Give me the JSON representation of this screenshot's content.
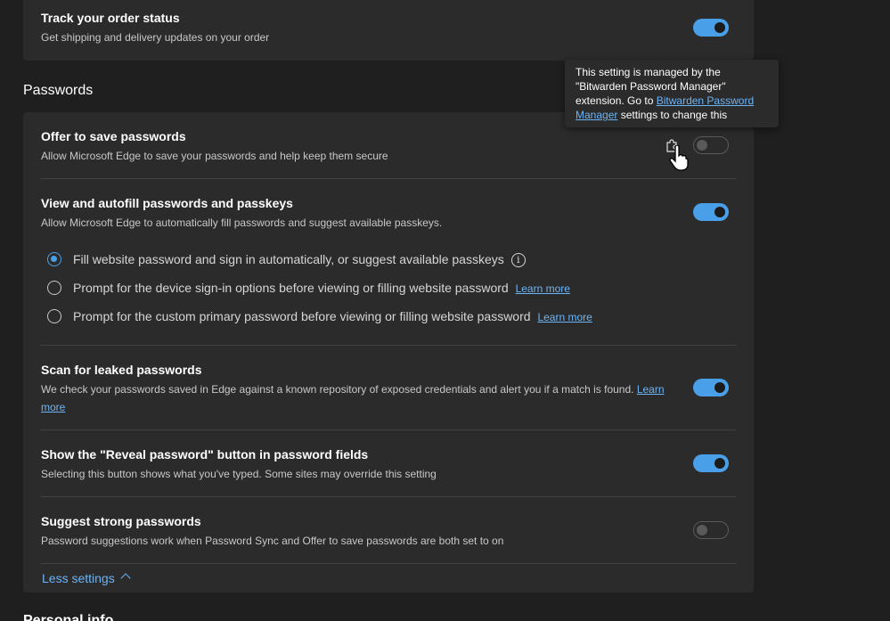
{
  "top_card": {
    "title": "Track your order status",
    "desc": "Get shipping and delivery updates on your order"
  },
  "passwords_section": {
    "heading": "Passwords",
    "offer_save": {
      "title": "Offer to save passwords",
      "desc": "Allow Microsoft Edge to save your passwords and help keep them secure"
    },
    "autofill": {
      "title": "View and autofill passwords and passkeys",
      "desc": "Allow Microsoft Edge to automatically fill passwords and suggest available passkeys.",
      "options": [
        {
          "label": "Fill website password and sign in automatically, or suggest available passkeys"
        },
        {
          "label": "Prompt for the device sign-in options before viewing or filling website password",
          "link": "Learn more"
        },
        {
          "label": "Prompt for the custom primary password before viewing or filling website password",
          "link": "Learn more"
        }
      ]
    },
    "leaked": {
      "title": "Scan for leaked passwords",
      "desc": "We check your passwords saved in Edge against a known repository of exposed credentials and alert you if a match is found.",
      "link_part1": "Learn",
      "link_part2": "more"
    },
    "reveal": {
      "title": "Show the \"Reveal password\" button in password fields",
      "desc": "Selecting this button shows what you've typed. Some sites may override this setting"
    },
    "suggest": {
      "title": "Suggest strong passwords",
      "desc": "Password suggestions work when Password Sync and Offer to save passwords are both set to on"
    },
    "less_settings": "Less settings"
  },
  "tooltip": {
    "line1": "This setting is managed by the",
    "line2": "\"Bitwarden Password Manager\"",
    "line3_pre": "extension. Go to",
    "link1": "Bitwarden Password",
    "link2": "Manager",
    "line4_post": "settings to change this"
  },
  "bottom_heading": "Personal info",
  "toggles": {
    "track_order": true,
    "offer_save": false,
    "autofill": true,
    "leaked": true,
    "reveal": true,
    "suggest": false
  },
  "autofill_selected_option": 0,
  "colors": {
    "accent": "#4aa0e8",
    "link": "#6cb4f5",
    "background": "#1f1f1f",
    "card": "#2b2b2b"
  },
  "icons": [
    "info-icon",
    "puzzle-extension-icon",
    "hand-cursor-icon",
    "chevron-up-icon"
  ]
}
